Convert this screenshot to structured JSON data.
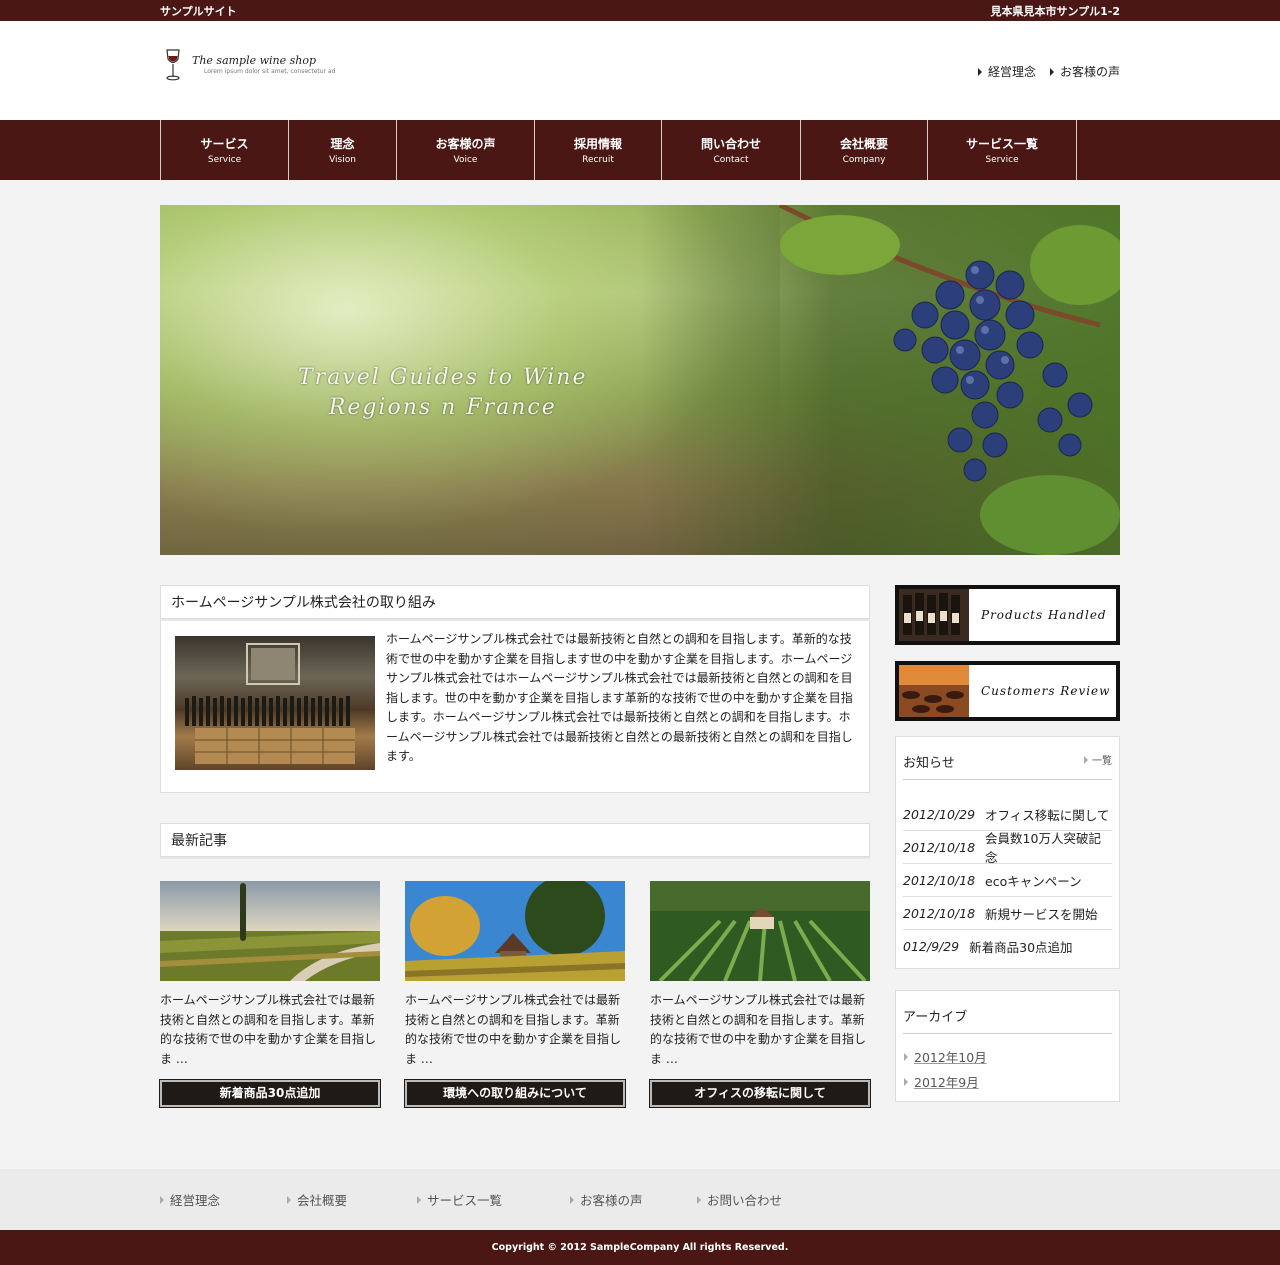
{
  "topbar": {
    "site_name": "サンプルサイト",
    "address": "見本県見本市サンプル1-2"
  },
  "logo": {
    "title": "The sample wine shop",
    "subtitle": "Lorem ipsum dolor sit amet, consectetur ad"
  },
  "header_links": [
    {
      "label": "経営理念"
    },
    {
      "label": "お客様の声"
    }
  ],
  "nav": [
    {
      "jp": "サービス",
      "en": "Service"
    },
    {
      "jp": "理念",
      "en": "Vision"
    },
    {
      "jp": "お客様の声",
      "en": "Voice"
    },
    {
      "jp": "採用情報",
      "en": "Recruit"
    },
    {
      "jp": "問い合わせ",
      "en": "Contact"
    },
    {
      "jp": "会社概要",
      "en": "Company"
    },
    {
      "jp": "サービス一覧",
      "en": "Service"
    }
  ],
  "hero": {
    "line1": "Travel Guides to Wine",
    "line2": "Regions n France"
  },
  "intro": {
    "heading": "ホームページサンプル株式会社の取り組み",
    "body": "ホームページサンプル株式会社では最新技術と自然との調和を目指します。革新的な技術で世の中を動かす企業を目指します世の中を動かす企業を目指します。ホームページサンプル株式会社ではホームページサンプル株式会社では最新技術と自然との調和を目指します。世の中を動かす企業を目指します革新的な技術で世の中を動かす企業を目指します。ホームページサンプル株式会社では最新技術と自然との調和を目指します。ホームページサンプル株式会社では最新技術と自然との最新技術と自然との調和を目指します。"
  },
  "latest": {
    "heading": "最新記事",
    "cards": [
      {
        "text": "ホームページサンプル株式会社では最新技術と自然との調和を目指します。革新的な技術で世の中を動かす企業を目指しま …",
        "button": "新着商品30点追加"
      },
      {
        "text": "ホームページサンプル株式会社では最新技術と自然との調和を目指します。革新的な技術で世の中を動かす企業を目指しま …",
        "button": "環境への取り組みについて"
      },
      {
        "text": "ホームページサンプル株式会社では最新技術と自然との調和を目指します。革新的な技術で世の中を動かす企業を目指しま …",
        "button": "オフィスの移転に関して"
      }
    ]
  },
  "banners": [
    {
      "label": "Products Handled"
    },
    {
      "label": "Customers Review"
    }
  ],
  "news": {
    "title": "お知らせ",
    "more": "一覧",
    "items": [
      {
        "date": "2012/10/29",
        "text": "オフィス移転に関して"
      },
      {
        "date": "2012/10/18",
        "text": "会員数10万人突破記念"
      },
      {
        "date": "2012/10/18",
        "text": "ecoキャンペーン"
      },
      {
        "date": "2012/10/18",
        "text": "新規サービスを開始"
      },
      {
        "date": "012/9/29",
        "text": "新着商品30点追加"
      }
    ]
  },
  "archive": {
    "title": "アーカイブ",
    "items": [
      {
        "label": "2012年10月"
      },
      {
        "label": "2012年9月"
      }
    ]
  },
  "footer": {
    "links": [
      {
        "label": "経営理念"
      },
      {
        "label": "会社概要"
      },
      {
        "label": "サービス一覧"
      },
      {
        "label": "お客様の声"
      },
      {
        "label": "お問い合わせ"
      }
    ],
    "copyright": "Copyright © 2012 SampleCompany All rights Reserved."
  },
  "colors": {
    "brand": "#4a1714",
    "background": "#f3f3f3",
    "button": "#1f1a16"
  }
}
